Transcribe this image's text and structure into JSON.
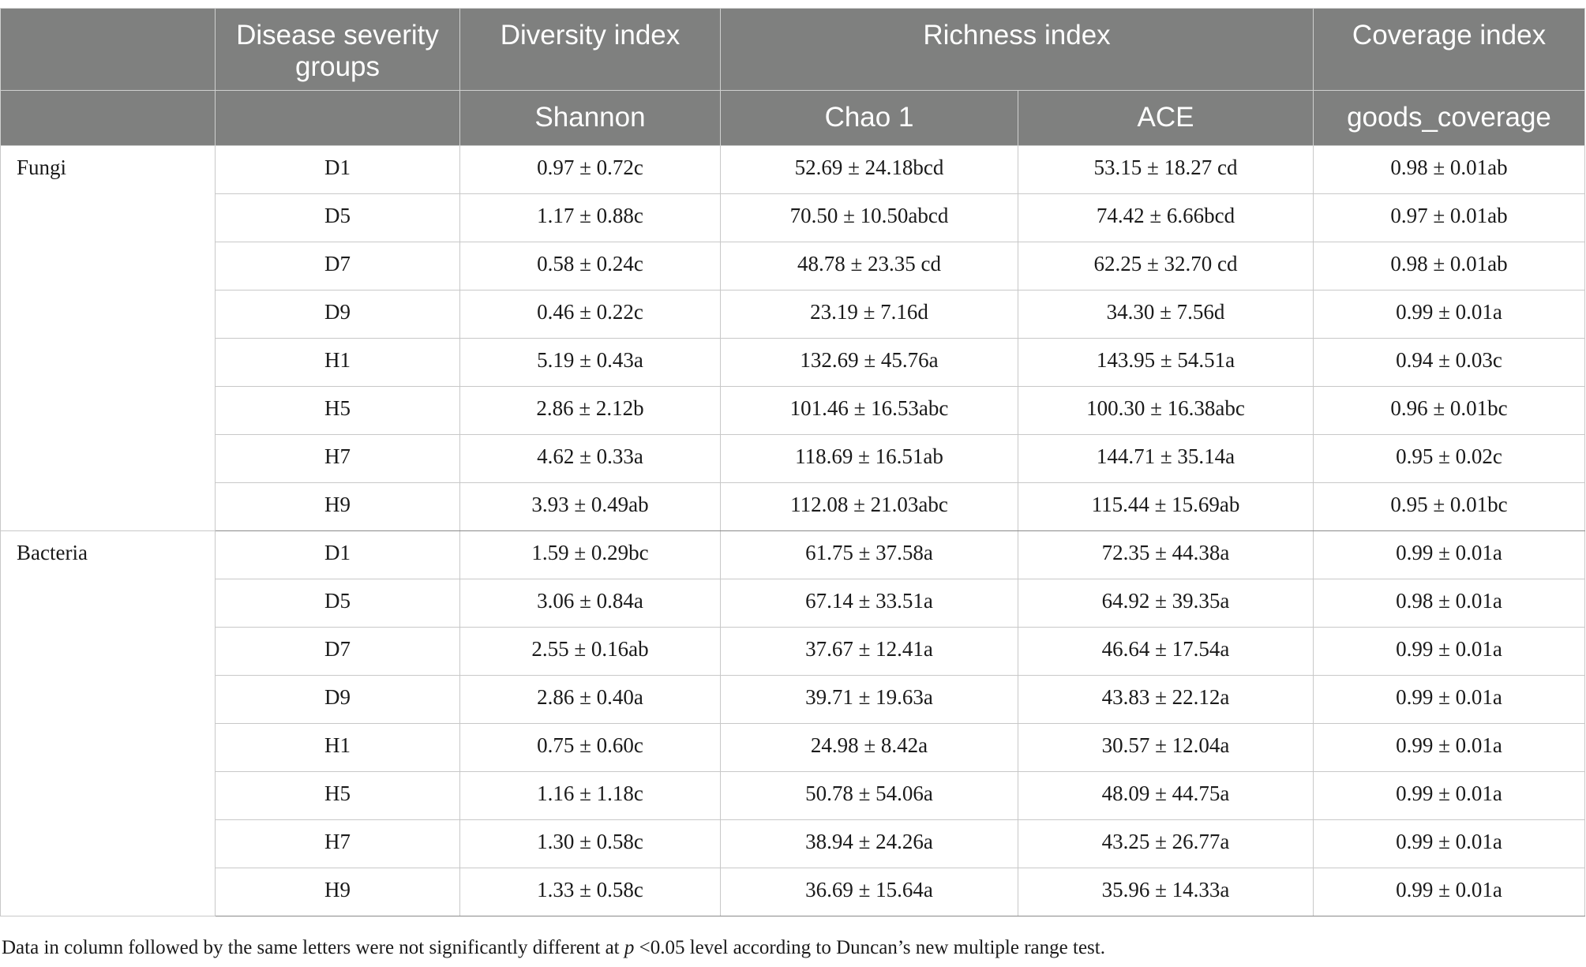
{
  "header": {
    "groups": "Disease severity groups",
    "diversity": "Diversity index",
    "richness": "Richness index",
    "coverage": "Coverage index",
    "shannon": "Shannon",
    "chao1": "Chao 1",
    "ace": "ACE",
    "goods": "goods_coverage"
  },
  "blocks": [
    {
      "category": "Fungi",
      "rows": [
        {
          "group": "D1",
          "shannon": "0.97 ± 0.72c",
          "chao1": "52.69 ± 24.18bcd",
          "ace": "53.15 ± 18.27 cd",
          "goods": "0.98 ± 0.01ab"
        },
        {
          "group": "D5",
          "shannon": "1.17 ± 0.88c",
          "chao1": "70.50 ± 10.50abcd",
          "ace": "74.42 ± 6.66bcd",
          "goods": "0.97 ± 0.01ab"
        },
        {
          "group": "D7",
          "shannon": "0.58 ± 0.24c",
          "chao1": "48.78 ± 23.35 cd",
          "ace": "62.25 ± 32.70 cd",
          "goods": "0.98 ± 0.01ab"
        },
        {
          "group": "D9",
          "shannon": "0.46 ± 0.22c",
          "chao1": "23.19 ± 7.16d",
          "ace": "34.30 ± 7.56d",
          "goods": "0.99 ± 0.01a"
        },
        {
          "group": "H1",
          "shannon": "5.19 ± 0.43a",
          "chao1": "132.69 ± 45.76a",
          "ace": "143.95 ± 54.51a",
          "goods": "0.94 ± 0.03c"
        },
        {
          "group": "H5",
          "shannon": "2.86 ± 2.12b",
          "chao1": "101.46 ± 16.53abc",
          "ace": "100.30 ± 16.38abc",
          "goods": "0.96 ± 0.01bc"
        },
        {
          "group": "H7",
          "shannon": "4.62 ± 0.33a",
          "chao1": "118.69 ± 16.51ab",
          "ace": "144.71 ± 35.14a",
          "goods": "0.95 ± 0.02c"
        },
        {
          "group": "H9",
          "shannon": "3.93 ± 0.49ab",
          "chao1": "112.08 ± 21.03abc",
          "ace": "115.44 ± 15.69ab",
          "goods": "0.95 ± 0.01bc"
        }
      ]
    },
    {
      "category": "Bacteria",
      "rows": [
        {
          "group": "D1",
          "shannon": "1.59 ± 0.29bc",
          "chao1": "61.75 ± 37.58a",
          "ace": "72.35 ± 44.38a",
          "goods": "0.99 ± 0.01a"
        },
        {
          "group": "D5",
          "shannon": "3.06 ± 0.84a",
          "chao1": "67.14 ± 33.51a",
          "ace": "64.92 ± 39.35a",
          "goods": "0.98 ± 0.01a"
        },
        {
          "group": "D7",
          "shannon": "2.55 ± 0.16ab",
          "chao1": "37.67 ± 12.41a",
          "ace": "46.64 ± 17.54a",
          "goods": "0.99 ± 0.01a"
        },
        {
          "group": "D9",
          "shannon": "2.86 ± 0.40a",
          "chao1": "39.71 ± 19.63a",
          "ace": "43.83 ± 22.12a",
          "goods": "0.99 ± 0.01a"
        },
        {
          "group": "H1",
          "shannon": "0.75 ± 0.60c",
          "chao1": "24.98 ± 8.42a",
          "ace": "30.57 ± 12.04a",
          "goods": "0.99 ± 0.01a"
        },
        {
          "group": "H5",
          "shannon": "1.16 ± 1.18c",
          "chao1": "50.78 ± 54.06a",
          "ace": "48.09 ± 44.75a",
          "goods": "0.99 ± 0.01a"
        },
        {
          "group": "H7",
          "shannon": "1.30 ± 0.58c",
          "chao1": "38.94 ± 24.26a",
          "ace": "43.25 ± 26.77a",
          "goods": "0.99 ± 0.01a"
        },
        {
          "group": "H9",
          "shannon": "1.33 ± 0.58c",
          "chao1": "36.69 ± 15.64a",
          "ace": "35.96 ± 14.33a",
          "goods": "0.99 ± 0.01a"
        }
      ]
    }
  ],
  "footnote": {
    "before": "Data in column followed by the same letters were not significantly different at ",
    "italic": "p",
    "after": " <0.05 level according to Duncan’s new multiple range test."
  }
}
